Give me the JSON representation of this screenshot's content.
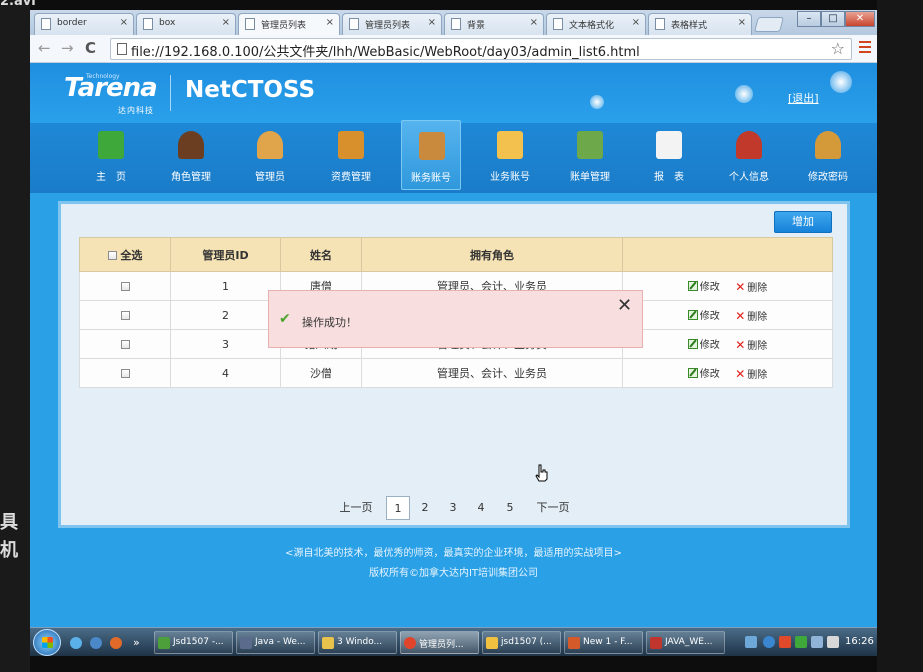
{
  "video_title": "2.avi",
  "left_glyphs": [
    "具",
    "机"
  ],
  "browser": {
    "tabs": [
      {
        "label": "border",
        "active": false
      },
      {
        "label": "box",
        "active": false
      },
      {
        "label": "管理员列表",
        "active": true
      },
      {
        "label": "管理员列表",
        "active": false
      },
      {
        "label": "背景",
        "active": false
      },
      {
        "label": "文本格式化",
        "active": false
      },
      {
        "label": "表格样式",
        "active": false
      }
    ],
    "tab_close": "×",
    "window_buttons": {
      "minimize": "–",
      "maximize": "□",
      "close": "✕"
    },
    "nav": {
      "back": "←",
      "forward": "→",
      "reload": "C"
    },
    "address": "file://192.168.0.100/公共文件夹/lhh/WebBasic/WebRoot/day03/admin_list6.html",
    "star": "☆"
  },
  "header": {
    "logo": "Tarena",
    "logo_tech": "Technology",
    "logo_sub": "达内科技",
    "product": "NetCTOSS",
    "logout": "[退出]"
  },
  "nav_items": [
    {
      "label": "主　页",
      "color": "#3fa83a",
      "active": false
    },
    {
      "label": "角色管理",
      "color": "#6b3e22",
      "active": false
    },
    {
      "label": "管理员",
      "color": "#e0a44a",
      "active": false
    },
    {
      "label": "资费管理",
      "color": "#d8902c",
      "active": false
    },
    {
      "label": "账务账号",
      "color": "#c98a3e",
      "active": true
    },
    {
      "label": "业务账号",
      "color": "#f2c14e",
      "active": false
    },
    {
      "label": "账单管理",
      "color": "#6da84a",
      "active": false
    },
    {
      "label": "报　表",
      "color": "#f3f3f3",
      "active": false
    },
    {
      "label": "个人信息",
      "color": "#c0392b",
      "active": false
    },
    {
      "label": "修改密码",
      "color": "#d49a3a",
      "active": false
    }
  ],
  "content": {
    "add_button": "增加",
    "columns": [
      "全选",
      "管理员ID",
      "姓名",
      "拥有角色",
      ""
    ],
    "rows": [
      {
        "id": "1",
        "name": "唐僧",
        "roles": "管理员、会计、业务员"
      },
      {
        "id": "2",
        "name": "",
        "roles": ""
      },
      {
        "id": "3",
        "name": "猪八戒",
        "roles": "管理员、会计、业务员"
      },
      {
        "id": "4",
        "name": "沙僧",
        "roles": "管理员、会计、业务员"
      }
    ],
    "actions": {
      "edit": "修改",
      "delete": "删除"
    },
    "toast": {
      "message": "操作成功！",
      "close": "✕",
      "check": "✔"
    },
    "pager": {
      "prev": "上一页",
      "pages": [
        "1",
        "2",
        "3",
        "4",
        "5"
      ],
      "current": "1",
      "next": "下一页"
    }
  },
  "footer": {
    "line1": "<源自北美的技术，最优秀的师资，最真实的企业环境，最适用的实战项目>",
    "line2": "版权所有©加拿大达内IT培训集团公司"
  },
  "taskbar": {
    "quick_launch_more": "»",
    "items": [
      {
        "label": "Jsd1507 -...",
        "color": "#4c9f3a",
        "active": false
      },
      {
        "label": "Java - We...",
        "color": "#5a6b8c",
        "active": false
      },
      {
        "label": "3 Windo...",
        "color": "#e8c24a",
        "active": false
      },
      {
        "label": "管理员列...",
        "color": "#e0452b",
        "active": true
      },
      {
        "label": "jsd1507 (...",
        "color": "#f0c040",
        "active": false
      },
      {
        "label": "New 1 - F...",
        "color": "#d55a2a",
        "active": false
      },
      {
        "label": "JAVA_WE...",
        "color": "#c0362c",
        "active": false
      }
    ],
    "clock": "16:26"
  }
}
